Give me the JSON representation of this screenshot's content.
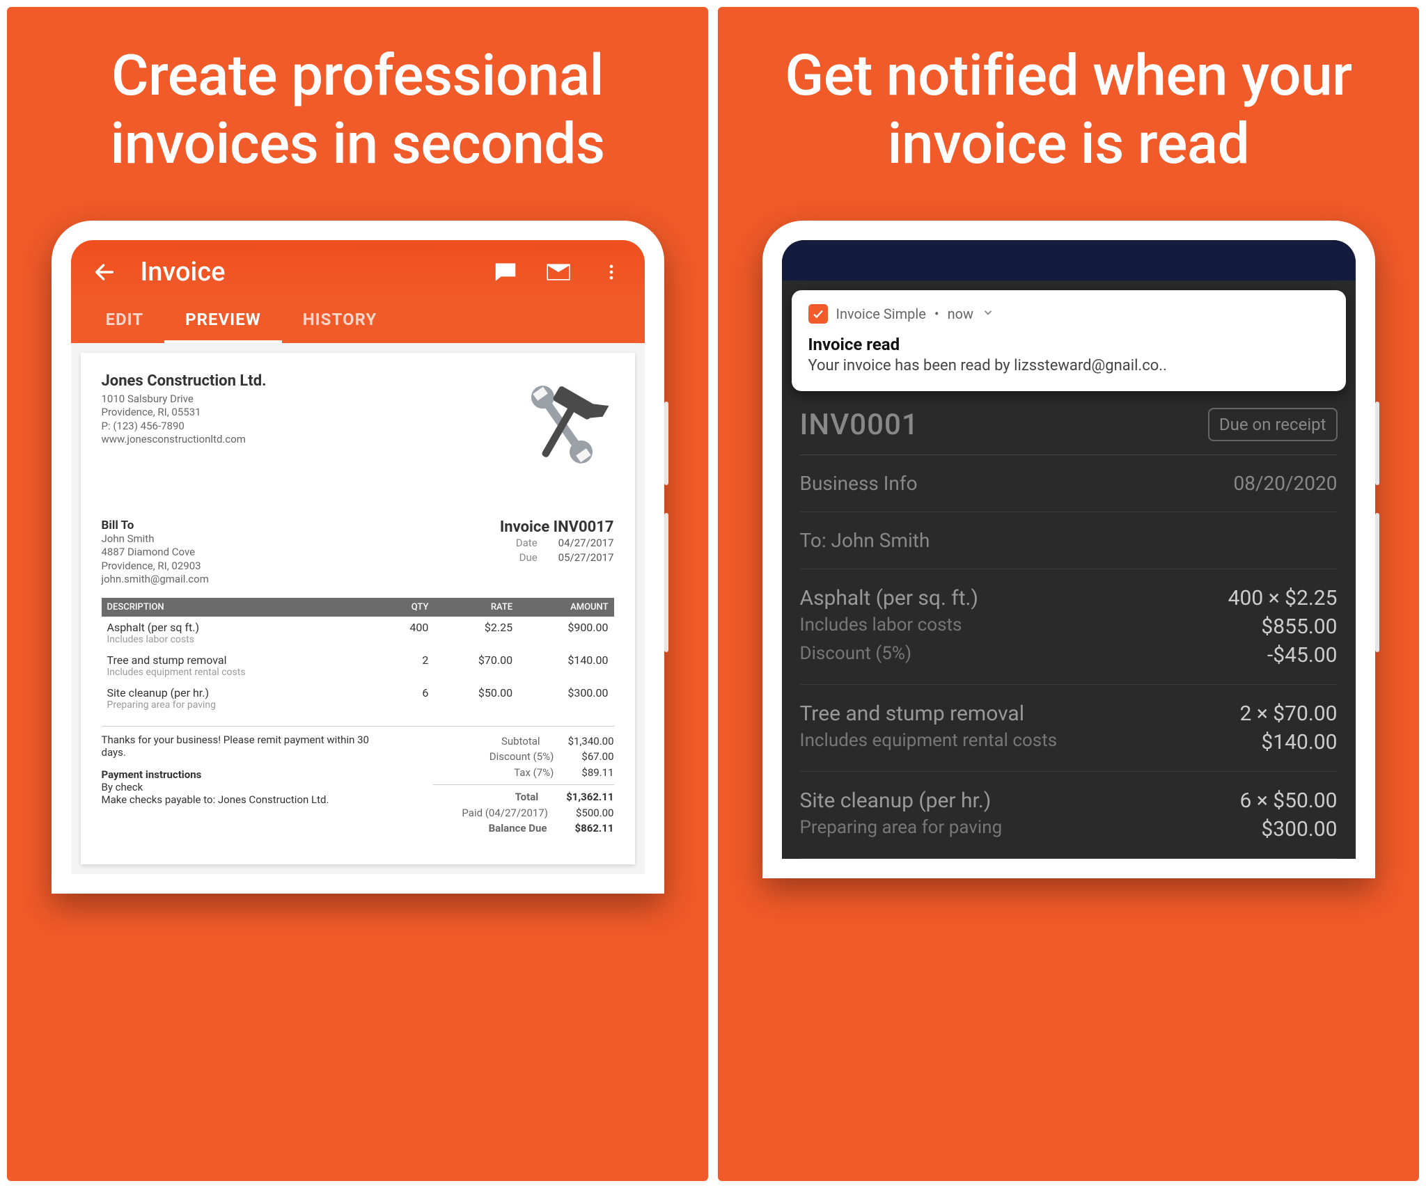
{
  "panel1": {
    "headline": "Create professional invoices in seconds",
    "appbar": {
      "title": "Invoice"
    },
    "tabs": {
      "edit": "EDIT",
      "preview": "PREVIEW",
      "history": "HISTORY"
    },
    "company": {
      "name": "Jones Construction Ltd.",
      "addr1": "1010 Salsbury Drive",
      "addr2": "Providence, RI, 05531",
      "phone": "P: (123) 456-7890",
      "web": "www.jonesconstructionltd.com"
    },
    "billto": {
      "heading": "Bill To",
      "name": "John Smith",
      "addr1": "4887 Diamond Cove",
      "addr2": "Providence, RI, 02903",
      "email": "john.smith@gmail.com"
    },
    "invoice": {
      "title": "Invoice INV0017",
      "date_label": "Date",
      "date": "04/27/2017",
      "due_label": "Due",
      "due": "05/27/2017"
    },
    "table": {
      "headers": {
        "desc": "DESCRIPTION",
        "qty": "QTY",
        "rate": "RATE",
        "amount": "AMOUNT"
      },
      "rows": [
        {
          "desc": "Asphalt (per sq ft.)",
          "sub": "Includes labor costs",
          "qty": "400",
          "rate": "$2.25",
          "amount": "$900.00"
        },
        {
          "desc": "Tree and stump removal",
          "sub": "Includes equipment rental costs",
          "qty": "2",
          "rate": "$70.00",
          "amount": "$140.00"
        },
        {
          "desc": "Site cleanup (per hr.)",
          "sub": "Preparing area for paving",
          "qty": "6",
          "rate": "$50.00",
          "amount": "$300.00"
        }
      ]
    },
    "footer": {
      "thanks": "Thanks for your business! Please remit payment within 30 days.",
      "instructions_head": "Payment instructions",
      "instr1": "By check",
      "instr2": "Make checks payable to: Jones Construction Ltd."
    },
    "totals": {
      "subtotal_label": "Subtotal",
      "subtotal": "$1,340.00",
      "discount_label": "Discount (5%)",
      "discount": "$67.00",
      "tax_label": "Tax (7%)",
      "tax": "$89.11",
      "total_label": "Total",
      "total": "$1,362.11",
      "paid_label": "Paid (04/27/2017)",
      "paid": "$500.00",
      "balance_label": "Balance Due",
      "balance": "$862.11"
    }
  },
  "panel2": {
    "headline": "Get notified when your invoice is read",
    "notif": {
      "app": "Invoice Simple",
      "time": "now",
      "title": "Invoice read",
      "body": "Your invoice has been read by lizssteward@gnail.co.."
    },
    "editor": {
      "inv_no": "INV0001",
      "due_chip": "Due on receipt",
      "biz_label": "Business Info",
      "date": "08/20/2020",
      "to_label": "To: John Smith",
      "items": [
        {
          "name": "Asphalt (per sq. ft.)",
          "qty_rate": "400 × $2.25",
          "sub": "Includes labor costs",
          "amount": "$855.00",
          "discount_label": "Discount (5%)",
          "discount": "-$45.00"
        },
        {
          "name": "Tree and stump removal",
          "qty_rate": "2 × $70.00",
          "sub": "Includes equipment rental costs",
          "amount": "$140.00"
        },
        {
          "name": "Site cleanup (per hr.)",
          "qty_rate": "6 × $50.00",
          "sub": "Preparing area for paving",
          "amount": "$300.00"
        }
      ]
    }
  }
}
